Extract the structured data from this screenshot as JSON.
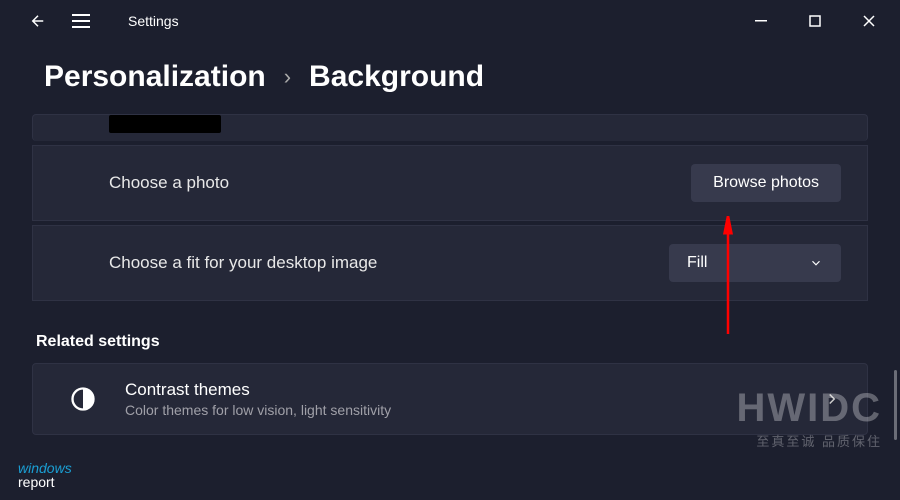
{
  "titlebar": {
    "title": "Settings"
  },
  "breadcrumb": {
    "parent": "Personalization",
    "current": "Background"
  },
  "settings": {
    "choose_photo_label": "Choose a photo",
    "browse_button": "Browse photos",
    "choose_fit_label": "Choose a fit for your desktop image",
    "fit_value": "Fill"
  },
  "related": {
    "header": "Related settings",
    "contrast_title": "Contrast themes",
    "contrast_sub": "Color themes for low vision, light sensitivity"
  },
  "watermarks": {
    "hwidc_big": "HWIDC",
    "hwidc_small": "至真至诚 品质保住",
    "wr_line1": "windows",
    "wr_line2": "report"
  }
}
